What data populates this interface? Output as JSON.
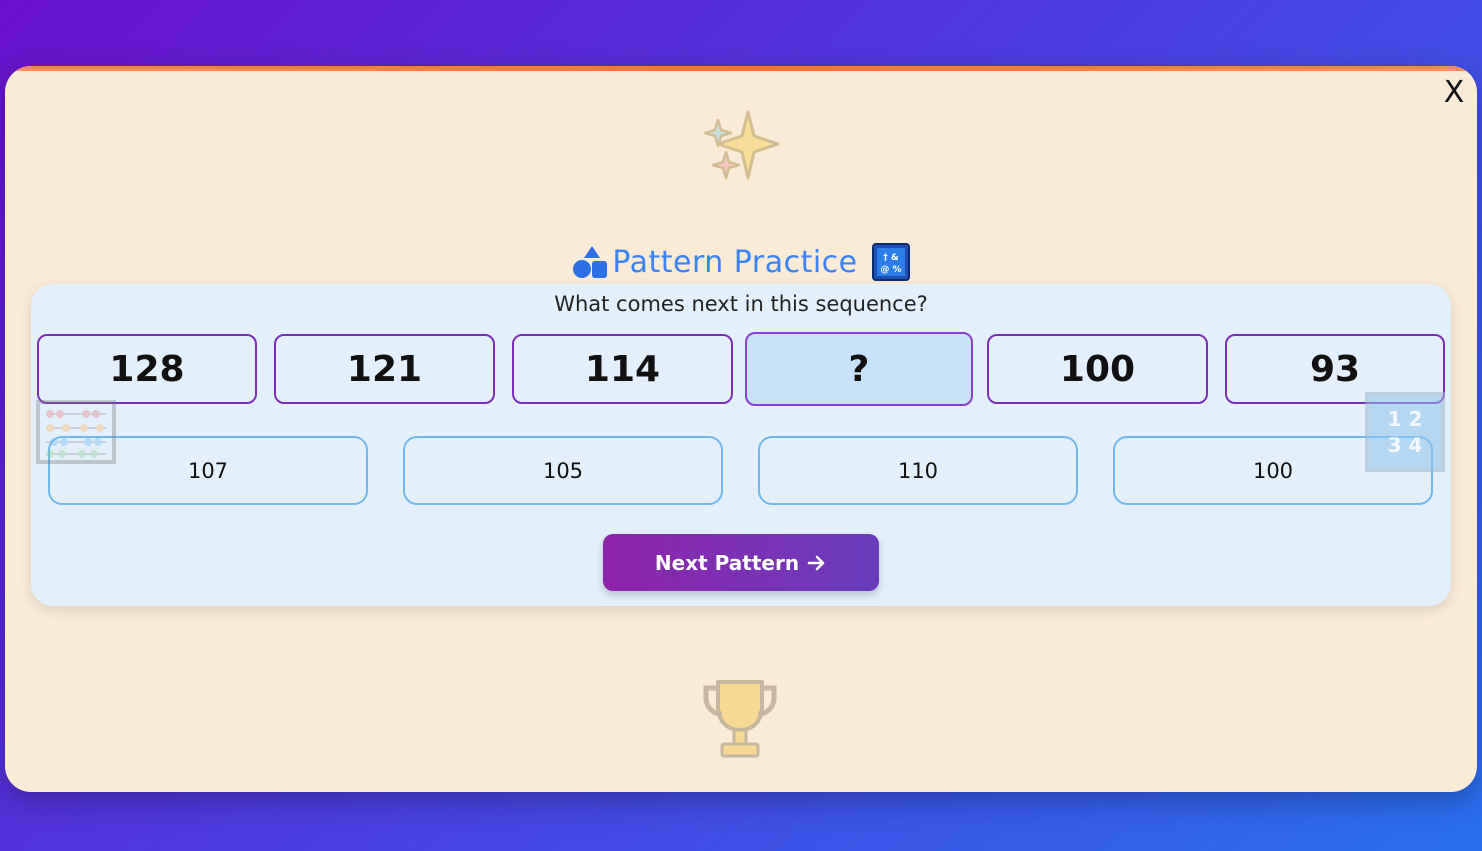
{
  "modal": {
    "close_label": "X",
    "title": "Pattern Practice",
    "title_left_icon": "shapes-icon",
    "title_right_icon": "symbols-icon",
    "top_decoration_icon": "sparkles-icon",
    "bottom_decoration_icon": "trophy-icon"
  },
  "question": {
    "prompt": "What comes next in this sequence?",
    "sequence": [
      "128",
      "121",
      "114",
      "?",
      "100",
      "93"
    ],
    "options": [
      "107",
      "105",
      "110",
      "100"
    ],
    "next_label": "Next Pattern"
  },
  "decorations": {
    "left_icon": "abacus-icon",
    "right_icon": "input-numbers-icon",
    "right_icon_text_line1": "1 2",
    "right_icon_text_line2": "3 4"
  },
  "colors": {
    "accent": "#3b82f6",
    "sequence_border": "#7b2cbf",
    "option_border": "#6fb8ee",
    "button_start": "#8e24aa",
    "button_end": "#6a3cbd",
    "modal_bg": "#faebd7",
    "panel_bg": "#e3f0fc"
  }
}
